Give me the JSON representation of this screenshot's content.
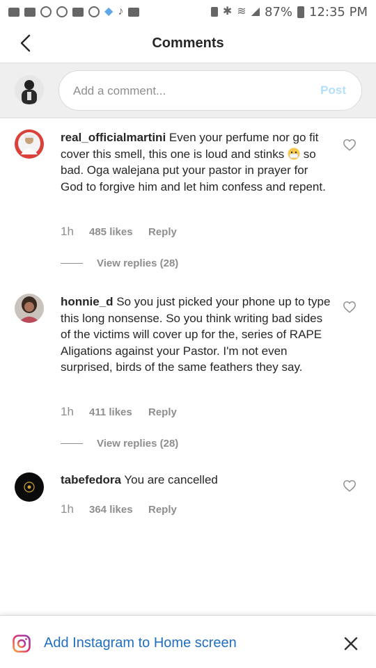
{
  "status_bar": {
    "battery": "87%",
    "time": "12:35 PM"
  },
  "header": {
    "title": "Comments"
  },
  "composer": {
    "placeholder": "Add a comment...",
    "post_label": "Post"
  },
  "comments": [
    {
      "username": "real_officialmartini",
      "text_before_emoji": " Even your perfume nor go fit cover this smell, this one is loud and stinks ",
      "text_after_emoji": " so bad. Oga walejana put your pastor in prayer for God to forgive him and let him confess and repent.",
      "time": "1h",
      "likes": "485 likes",
      "reply": "Reply",
      "replies": "View replies (28)"
    },
    {
      "username": "honnie_d",
      "text": " So you just picked your phone up to type this long nonsense. So you think writing bad sides of the victims will cover up for the, series of RAPE Aligations against your Pastor. I'm not even surprised, birds of the same feathers they say.",
      "time": "1h",
      "likes": "411 likes",
      "reply": "Reply",
      "replies": "View replies (28)"
    },
    {
      "username": "tabefedora",
      "text": " You are cancelled",
      "time": "1h",
      "likes": "364 likes",
      "reply": "Reply"
    }
  ],
  "banner": {
    "label": "Add Instagram to Home screen"
  },
  "icons": {
    "back": "chevron-left-icon",
    "heart": "heart-outline-icon",
    "close": "close-icon",
    "instagram": "instagram-icon",
    "emoji": "face-with-medical-mask-emoji"
  },
  "colors": {
    "link_blue": "#1f6fbf",
    "post_disabled": "#b2dffc",
    "muted": "#8e8e8e"
  }
}
